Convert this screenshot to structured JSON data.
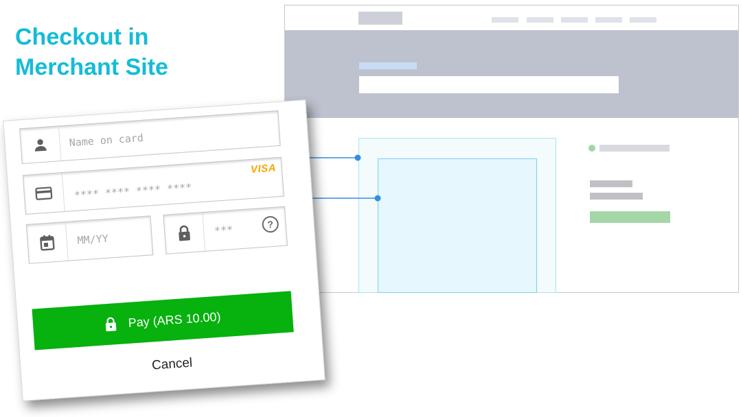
{
  "heading": {
    "line1": "Checkout in",
    "line2": "Merchant Site"
  },
  "checkout": {
    "name_placeholder": "Name on card",
    "card_placeholder": "**** **** **** ****",
    "card_brand": "VISA",
    "expiry_placeholder": "MM/YY",
    "cvv_placeholder": "***",
    "help_symbol": "?",
    "pay_label": "Pay (ARS 10.00)",
    "cancel_label": "Cancel"
  },
  "icons": {
    "person": "person-icon",
    "card": "credit-card-icon",
    "calendar": "calendar-icon",
    "lock": "lock-icon",
    "help": "help-icon"
  },
  "colors": {
    "heading": "#14bcd6",
    "pay_button": "#07b10e",
    "site_hero": "#bdc2ce",
    "iframe_border": "#7cd0ea",
    "connector": "#2f8fe0"
  }
}
